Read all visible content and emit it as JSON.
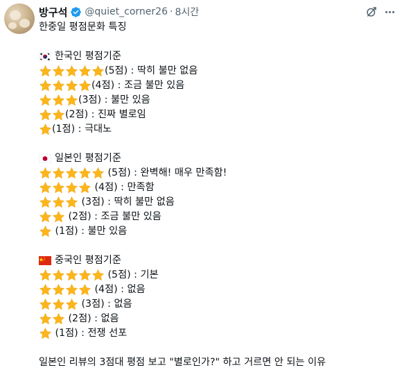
{
  "author": {
    "name": "방구석",
    "handle": "@quiet_corner26",
    "time": "8시간"
  },
  "icons": {
    "verified": "verified-badge-icon",
    "grok": "grok-icon",
    "more": "more-options-icon",
    "star": "star-icon",
    "flags": [
      "korea-flag-icon",
      "japan-flag-icon",
      "china-flag-icon"
    ]
  },
  "colors": {
    "verified": "#1d9bf0",
    "star": "#fcb61c",
    "secondary_text": "#536471"
  },
  "post": {
    "title": "한중일 평점문화 특징",
    "sections": [
      {
        "heading": "한국인 평점기준",
        "flag": "kr",
        "items": [
          {
            "stars": 5,
            "text": "(5점) : 딱히 불만 없음"
          },
          {
            "stars": 4,
            "text": "(4점) : 조금 불만 있음"
          },
          {
            "stars": 3,
            "text": "(3점) : 불만 있음"
          },
          {
            "stars": 2,
            "text": "(2점) : 진짜 별로임"
          },
          {
            "stars": 1,
            "text": "(1점) : 극대노"
          }
        ]
      },
      {
        "heading": "일본인 평점기준",
        "flag": "jp",
        "items": [
          {
            "stars": 5,
            "text": " (5점) : 완벽해! 매우 만족함!"
          },
          {
            "stars": 4,
            "text": " (4점) : 만족함"
          },
          {
            "stars": 3,
            "text": " (3점) : 딱히 불만 없음"
          },
          {
            "stars": 2,
            "text": " (2점) : 조금 불만 있음"
          },
          {
            "stars": 1,
            "text": " (1점) : 불만 있음"
          }
        ]
      },
      {
        "heading": "중국인 평점기준",
        "flag": "cn",
        "items": [
          {
            "stars": 5,
            "text": " (5점) : 기본"
          },
          {
            "stars": 4,
            "text": " (4점) : 없음"
          },
          {
            "stars": 3,
            "text": " (3점) : 없음"
          },
          {
            "stars": 2,
            "text": " (2점) : 없음"
          },
          {
            "stars": 1,
            "text": " (1점) : 전쟁 선포"
          }
        ]
      }
    ],
    "closing": "일본인 리뷰의 3점대 평점 보고 \"별로인가?\" 하고 거르면 안 되는 이유"
  }
}
